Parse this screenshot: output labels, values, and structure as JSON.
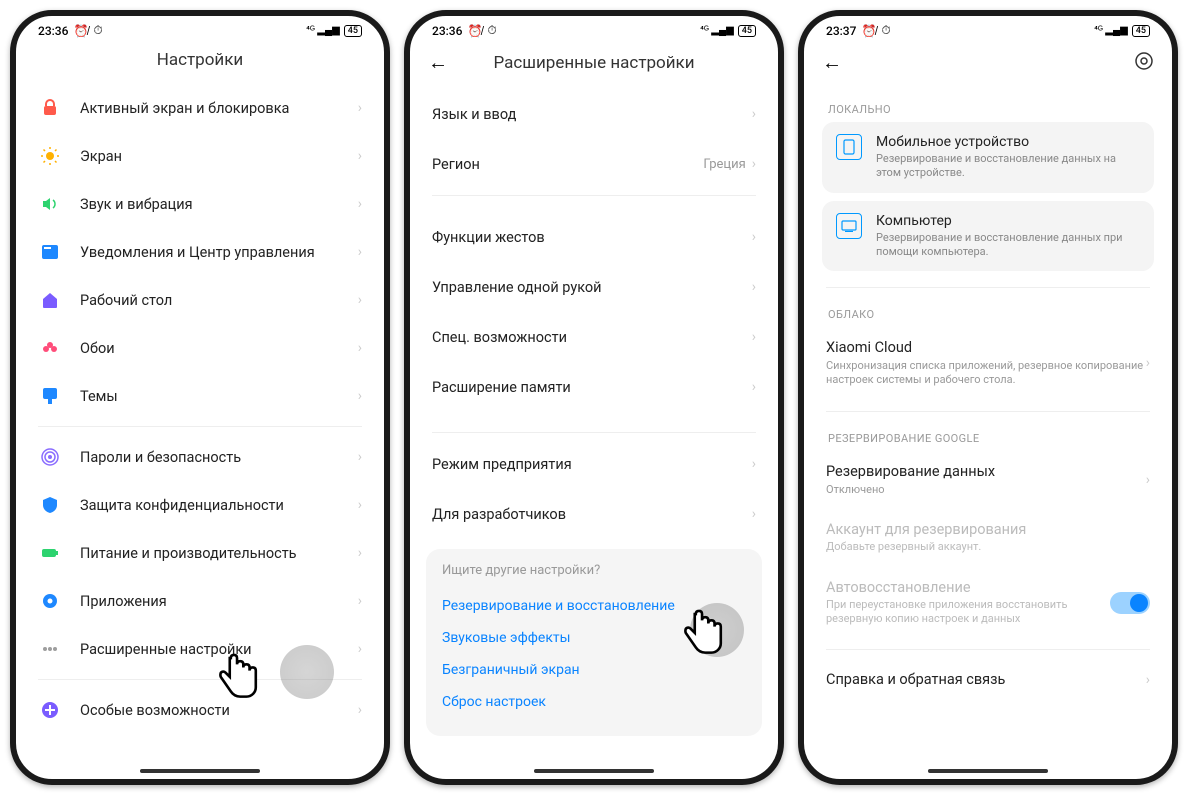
{
  "status": {
    "time1": "23:36",
    "time2": "23:36",
    "time3": "23:37",
    "signal": "⁴ᴳ ₊ıll",
    "batt": "45"
  },
  "p1": {
    "title": "Настройки",
    "items": [
      {
        "icon": "lock",
        "label": "Активный экран и блокировка",
        "color": "#ff5a4b"
      },
      {
        "icon": "sun",
        "label": "Экран",
        "color": "#ffb100"
      },
      {
        "icon": "vol",
        "label": "Звук и вибрация",
        "color": "#2dd36f"
      },
      {
        "icon": "bell",
        "label": "Уведомления и Центр управления",
        "color": "#1e88ff"
      },
      {
        "icon": "home",
        "label": "Рабочий стол",
        "color": "#7a5cff"
      },
      {
        "icon": "flower",
        "label": "Обои",
        "color": "#ff4d7a"
      },
      {
        "icon": "brush",
        "label": "Темы",
        "color": "#1e88ff"
      }
    ],
    "items2": [
      {
        "icon": "shield",
        "label": "Пароли и безопасность",
        "color": "#8a6cff"
      },
      {
        "icon": "shield2",
        "label": "Защита конфиденциальности",
        "color": "#1e88ff"
      },
      {
        "icon": "batt",
        "label": "Питание и производительность",
        "color": "#2dd36f"
      },
      {
        "icon": "gear",
        "label": "Приложения",
        "color": "#1e88ff"
      },
      {
        "icon": "dots",
        "label": "Расширенные настройки",
        "color": "#9e9e9e"
      }
    ],
    "items3": [
      {
        "icon": "acc",
        "label": "Особые возможности",
        "color": "#7a5cff"
      }
    ]
  },
  "p2": {
    "title": "Расширенные настройки",
    "g1": [
      {
        "label": "Язык и ввод"
      },
      {
        "label": "Регион",
        "value": "Греция"
      }
    ],
    "g2": [
      {
        "label": "Функции жестов"
      },
      {
        "label": "Управление одной рукой"
      },
      {
        "label": "Спец. возможности"
      },
      {
        "label": "Расширение памяти"
      }
    ],
    "g3": [
      {
        "label": "Режим предприятия"
      },
      {
        "label": "Для разработчиков"
      }
    ],
    "footer": {
      "hint": "Ищите другие настройки?",
      "links": [
        "Резервирование и восстановление",
        "Звуковые эффекты",
        "Безграничный экран",
        "Сброс настроек"
      ]
    }
  },
  "p3": {
    "sec1": "ЛОКАЛЬНО",
    "card1": {
      "title": "Мобильное устройство",
      "desc": "Резервирование и восстановление данных на этом устройстве."
    },
    "card2": {
      "title": "Компьютер",
      "desc": "Резервирование и восстановление данных при помощи компьютера."
    },
    "sec2": "ОБЛАКО",
    "cloud": {
      "title": "Xiaomi Cloud",
      "desc": "Синхронизация списка приложений, резервное копирование настроек системы и рабочего стола."
    },
    "sec3": "РЕЗЕРВИРОВАНИЕ GOOGLE",
    "g1": {
      "title": "Резервирование данных",
      "sub": "Отключено"
    },
    "g2": {
      "title": "Аккаунт для резервирования",
      "sub": "Добавьте резервный аккаунт."
    },
    "g3": {
      "title": "Автовосстановление",
      "sub": "При переустановке приложения восстановить резервную копию настроек и данных"
    },
    "help": "Справка и обратная связь"
  }
}
